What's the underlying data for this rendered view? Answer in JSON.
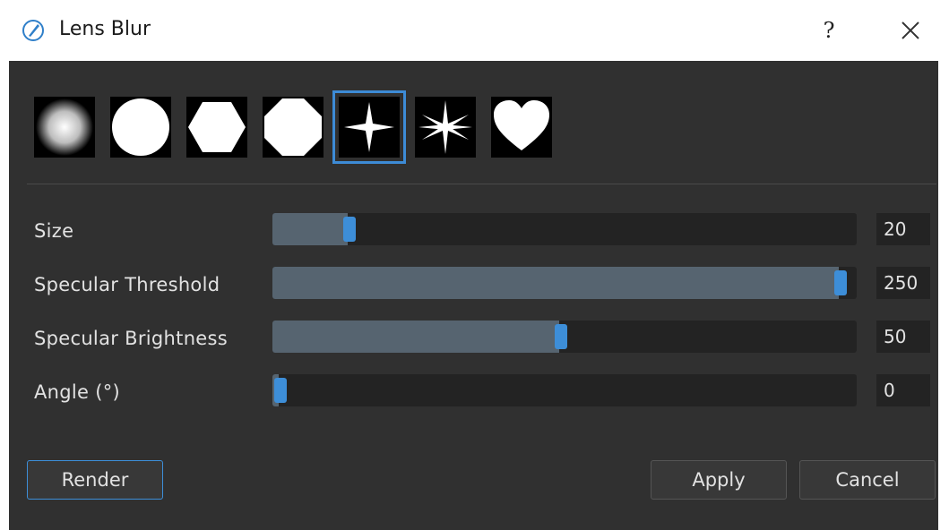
{
  "window": {
    "title": "Lens Blur",
    "help_label": "?",
    "icon": "pen-nib-icon",
    "close_icon": "close-icon"
  },
  "shapes": {
    "items": [
      {
        "name": "gaussian-shape-icon",
        "selected": false
      },
      {
        "name": "circle-shape-icon",
        "selected": false
      },
      {
        "name": "hexagon-shape-icon",
        "selected": false
      },
      {
        "name": "octagon-shape-icon",
        "selected": false
      },
      {
        "name": "four-point-star-shape-icon",
        "selected": true
      },
      {
        "name": "six-point-star-shape-icon",
        "selected": false
      },
      {
        "name": "heart-shape-icon",
        "selected": false
      }
    ]
  },
  "sliders": [
    {
      "label": "Size",
      "value": "20",
      "fraction": 0.12
    },
    {
      "label": "Specular Threshold",
      "value": "250",
      "fraction": 0.98
    },
    {
      "label": "Specular Brightness",
      "value": "50",
      "fraction": 0.49
    },
    {
      "label": "Angle (°)",
      "value": "0",
      "fraction": 0.0
    }
  ],
  "buttons": {
    "render": "Render",
    "apply": "Apply",
    "cancel": "Cancel"
  },
  "colors": {
    "accent": "#3d8ed8",
    "panel": "#303030",
    "track": "#232323",
    "fill": "#566470"
  }
}
